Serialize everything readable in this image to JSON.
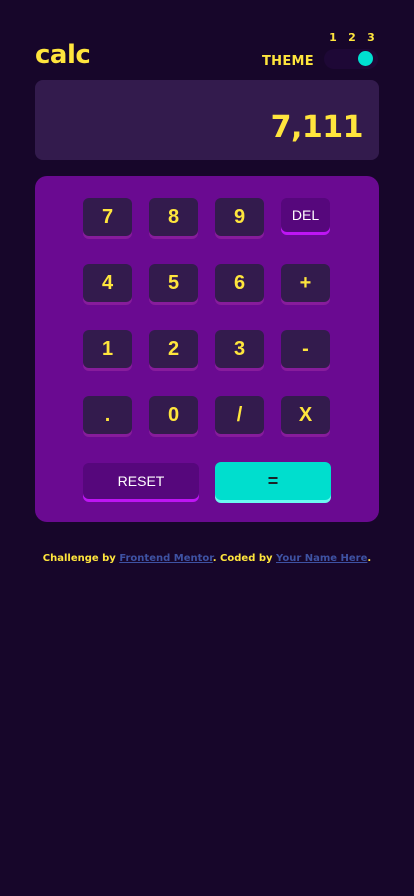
{
  "header": {
    "logo": "calc",
    "theme_label": "THEME",
    "theme_options": [
      "1",
      "2",
      "3"
    ],
    "selected_theme": "3"
  },
  "display": {
    "value": "7,111"
  },
  "keypad": {
    "rows": [
      [
        "7",
        "8",
        "9",
        "DEL"
      ],
      [
        "4",
        "5",
        "6",
        "+"
      ],
      [
        "1",
        "2",
        "3",
        "-"
      ],
      [
        ".",
        "0",
        "/",
        "X"
      ]
    ],
    "reset_label": "RESET",
    "equals_label": "="
  },
  "footer": {
    "challenge_prefix": "Challenge by",
    "challenge_link": "Frontend Mentor",
    "coded_prefix": ". Coded by",
    "coded_link": "Your Name Here",
    "suffix": "."
  },
  "colors": {
    "background": "#17062a",
    "accent_text": "#ffe53d",
    "keypad_bg": "#6a0a91",
    "key_bg": "#331b4d",
    "equals_bg": "#00dece",
    "toggle_knob": "#00e0d1",
    "link": "#3e52a3"
  }
}
